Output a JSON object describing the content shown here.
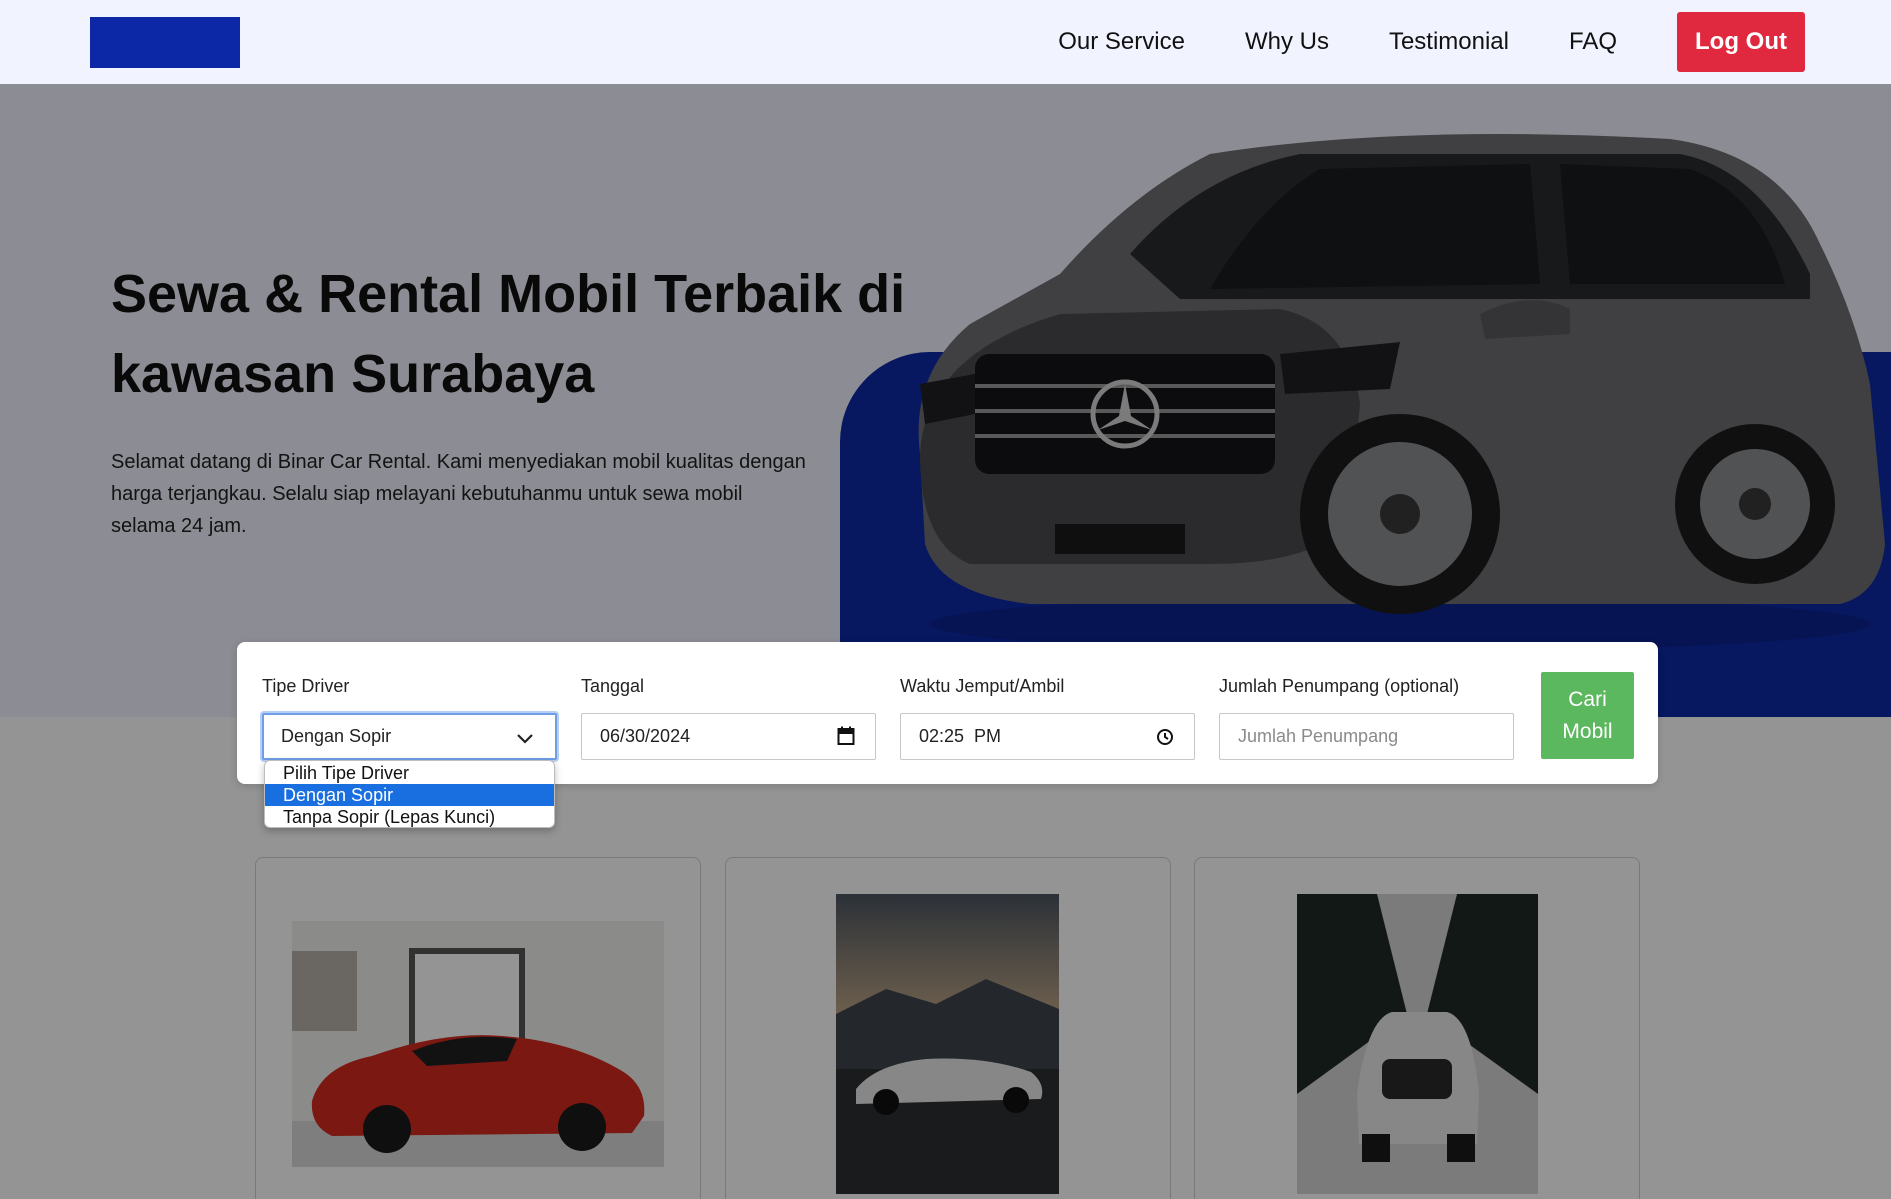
{
  "navbar": {
    "links": [
      "Our Service",
      "Why Us",
      "Testimonial",
      "FAQ"
    ],
    "logout_label": "Log Out"
  },
  "hero": {
    "title": "Sewa & Rental Mobil Terbaik di kawasan Surabaya",
    "description": "Selamat datang di Binar Car Rental. Kami menyediakan mobil kualitas dengan harga terjangkau. Selalu siap melayani kebutuhanmu untuk sewa mobil selama 24 jam."
  },
  "search": {
    "driver_label": "Tipe Driver",
    "driver_value": "Dengan Sopir",
    "date_label": "Tanggal",
    "date_value": "06/30/2024",
    "time_label": "Waktu Jemput/Ambil",
    "time_value": "02:25  PM",
    "passenger_label": "Jumlah Penumpang (optional)",
    "passenger_placeholder": "Jumlah Penumpang",
    "button_label": "Cari Mobil"
  },
  "dropdown": {
    "options": [
      "Pilih Tipe Driver",
      "Dengan Sopir",
      "Tanpa Sopir (Lepas Kunci)"
    ],
    "selected_index": 1
  },
  "colors": {
    "brand_blue": "#0d28a6",
    "logout_red": "#e0283f",
    "search_green": "#5cb85f",
    "option_highlight": "#1a6fe0"
  }
}
